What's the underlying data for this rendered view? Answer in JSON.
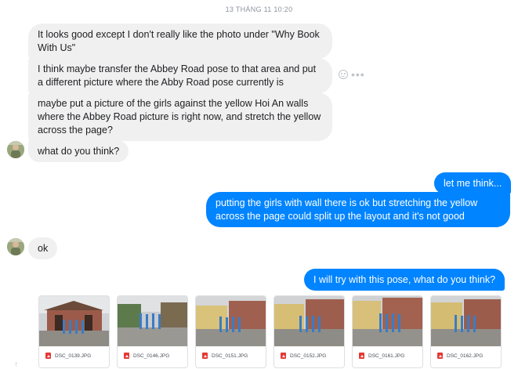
{
  "conversation": {
    "timestamp": "13 THÁNG 11 10:20"
  },
  "messages": [
    {
      "id": "m1",
      "sender": "other",
      "text": "It looks good except I don't really like the photo under \"Why Book With Us\""
    },
    {
      "id": "m2",
      "sender": "other",
      "text": "I think maybe transfer the Abbey Road pose to that area and put a different picture where the Abby Road pose currently is"
    },
    {
      "id": "m3",
      "sender": "other",
      "text": "maybe put a picture of the girls against the yellow Hoi An walls where the Abbey Road picture is right now, and stretch the yellow across the page?"
    },
    {
      "id": "m4",
      "sender": "other",
      "text": "what do you think?"
    },
    {
      "id": "m5",
      "sender": "me",
      "text": "let me think..."
    },
    {
      "id": "m6",
      "sender": "me",
      "text": "putting the girls with wall there is ok but stretching the yellow across the page could split up the layout and it's not good"
    },
    {
      "id": "m7",
      "sender": "other",
      "text": "ok"
    },
    {
      "id": "m8",
      "sender": "me",
      "text": "I will try with this pose, what do you think?"
    }
  ],
  "attachments": [
    {
      "name": "DSC_0139.JPG",
      "icon": "image-file-icon"
    },
    {
      "name": "DSC_0146.JPG",
      "icon": "image-file-icon"
    },
    {
      "name": "DSC_0151.JPG",
      "icon": "image-file-icon"
    },
    {
      "name": "DSC_0152.JPG",
      "icon": "image-file-icon"
    },
    {
      "name": "DSC_0161.JPG",
      "icon": "image-file-icon"
    },
    {
      "name": "DSC_0162.JPG",
      "icon": "image-file-icon"
    }
  ],
  "reactions": {
    "icons": [
      "smiley-icon",
      "more-icon"
    ],
    "more_glyph": "•••"
  },
  "colors": {
    "outgoing_bubble": "#0084ff",
    "incoming_bubble": "#f1f0f0",
    "timestamp": "#8d949e"
  }
}
